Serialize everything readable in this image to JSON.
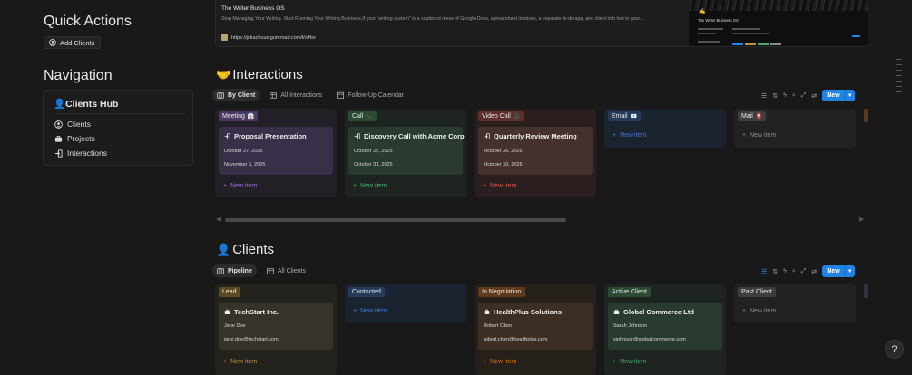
{
  "quick_actions": {
    "title": "Quick Actions",
    "add_clients_label": "Add Clients"
  },
  "navigation": {
    "title": "Navigation",
    "hub_title": "👤Clients Hub",
    "items": [
      {
        "label": "Clients",
        "icon": "user-circle-icon"
      },
      {
        "label": "Projects",
        "icon": "briefcase-icon"
      },
      {
        "label": "Interactions",
        "icon": "log-in-icon"
      }
    ]
  },
  "bookmark": {
    "title": "The Writer Business OS",
    "description": "Stop Managing Your Writing. Start Running Your Writing Business.If your \"writing system\" is a scattered mess of Google Docs, spreadsheet invoices, a separate to-do app, and client info lost in your...",
    "url": "https://pikachuux.gumroad.com/l/ofrlio",
    "thumb_title": "The Writer Business OS"
  },
  "interactions": {
    "title": "Interactions",
    "title_emoji": "🤝",
    "tabs": [
      {
        "label": "By Client",
        "icon": "board-icon"
      },
      {
        "label": "All Interactions",
        "icon": "table-icon"
      },
      {
        "label": "Follow-Up Calendar",
        "icon": "calendar-icon"
      }
    ],
    "new_label": "New",
    "columns": [
      {
        "tag": "Meeting",
        "emoji": "👔",
        "cards": [
          {
            "title": "Proposal Presentation",
            "lines": [
              "October 27, 2025",
              "November 3, 2025"
            ]
          }
        ],
        "new_item": "New item"
      },
      {
        "tag": "Call",
        "emoji": "📞",
        "cards": [
          {
            "title": "Discovery Call with Acme Corp",
            "lines": [
              "October 25, 2025",
              "October 31, 2025"
            ]
          }
        ],
        "new_item": "New item"
      },
      {
        "tag": "Video Call",
        "emoji": "🎥",
        "cards": [
          {
            "title": "Quarterly Review Meeting",
            "lines": [
              "October 26, 2025",
              "October 29, 2025"
            ]
          }
        ],
        "new_item": "New item"
      },
      {
        "tag": "Email",
        "emoji": "📧",
        "cards": [],
        "new_item": "New item"
      },
      {
        "tag": "Mail",
        "emoji": "📮",
        "cards": [],
        "new_item": "New item"
      }
    ]
  },
  "clients": {
    "title": "Clients",
    "title_emoji": "👤",
    "tabs": [
      {
        "label": "Pipeline",
        "icon": "board-icon"
      },
      {
        "label": "All Clients",
        "icon": "table-icon"
      }
    ],
    "new_label": "New",
    "columns": [
      {
        "tag": "Lead",
        "cards": [
          {
            "title": "TechStart Inc.",
            "lines": [
              "Jane Doe",
              "jane.doe@techstart.com"
            ]
          }
        ],
        "new_item": "New item"
      },
      {
        "tag": "Contacted",
        "cards": [],
        "new_item": "New item"
      },
      {
        "tag": "In Negotiation",
        "cards": [
          {
            "title": "HealthPlus Solutions",
            "lines": [
              "Robert Chen",
              "robert.chen@healthplus.com"
            ]
          }
        ],
        "new_item": "New item"
      },
      {
        "tag": "Active Client",
        "cards": [
          {
            "title": "Global Commerce Ltd",
            "lines": [
              "Sarah Johnson",
              "sjohnson@globalcommerce.com"
            ]
          }
        ],
        "new_item": "New item"
      },
      {
        "tag": "Past Client",
        "cards": [],
        "new_item": "New item"
      }
    ]
  },
  "colors": {
    "accent": "#2383e2",
    "purple": "#9a6dd7",
    "green": "#4dab6f",
    "red": "#df5452",
    "blue": "#447acb",
    "gray": "#8b8b8b",
    "brown": "#c29243",
    "orange": "#d9730d"
  }
}
